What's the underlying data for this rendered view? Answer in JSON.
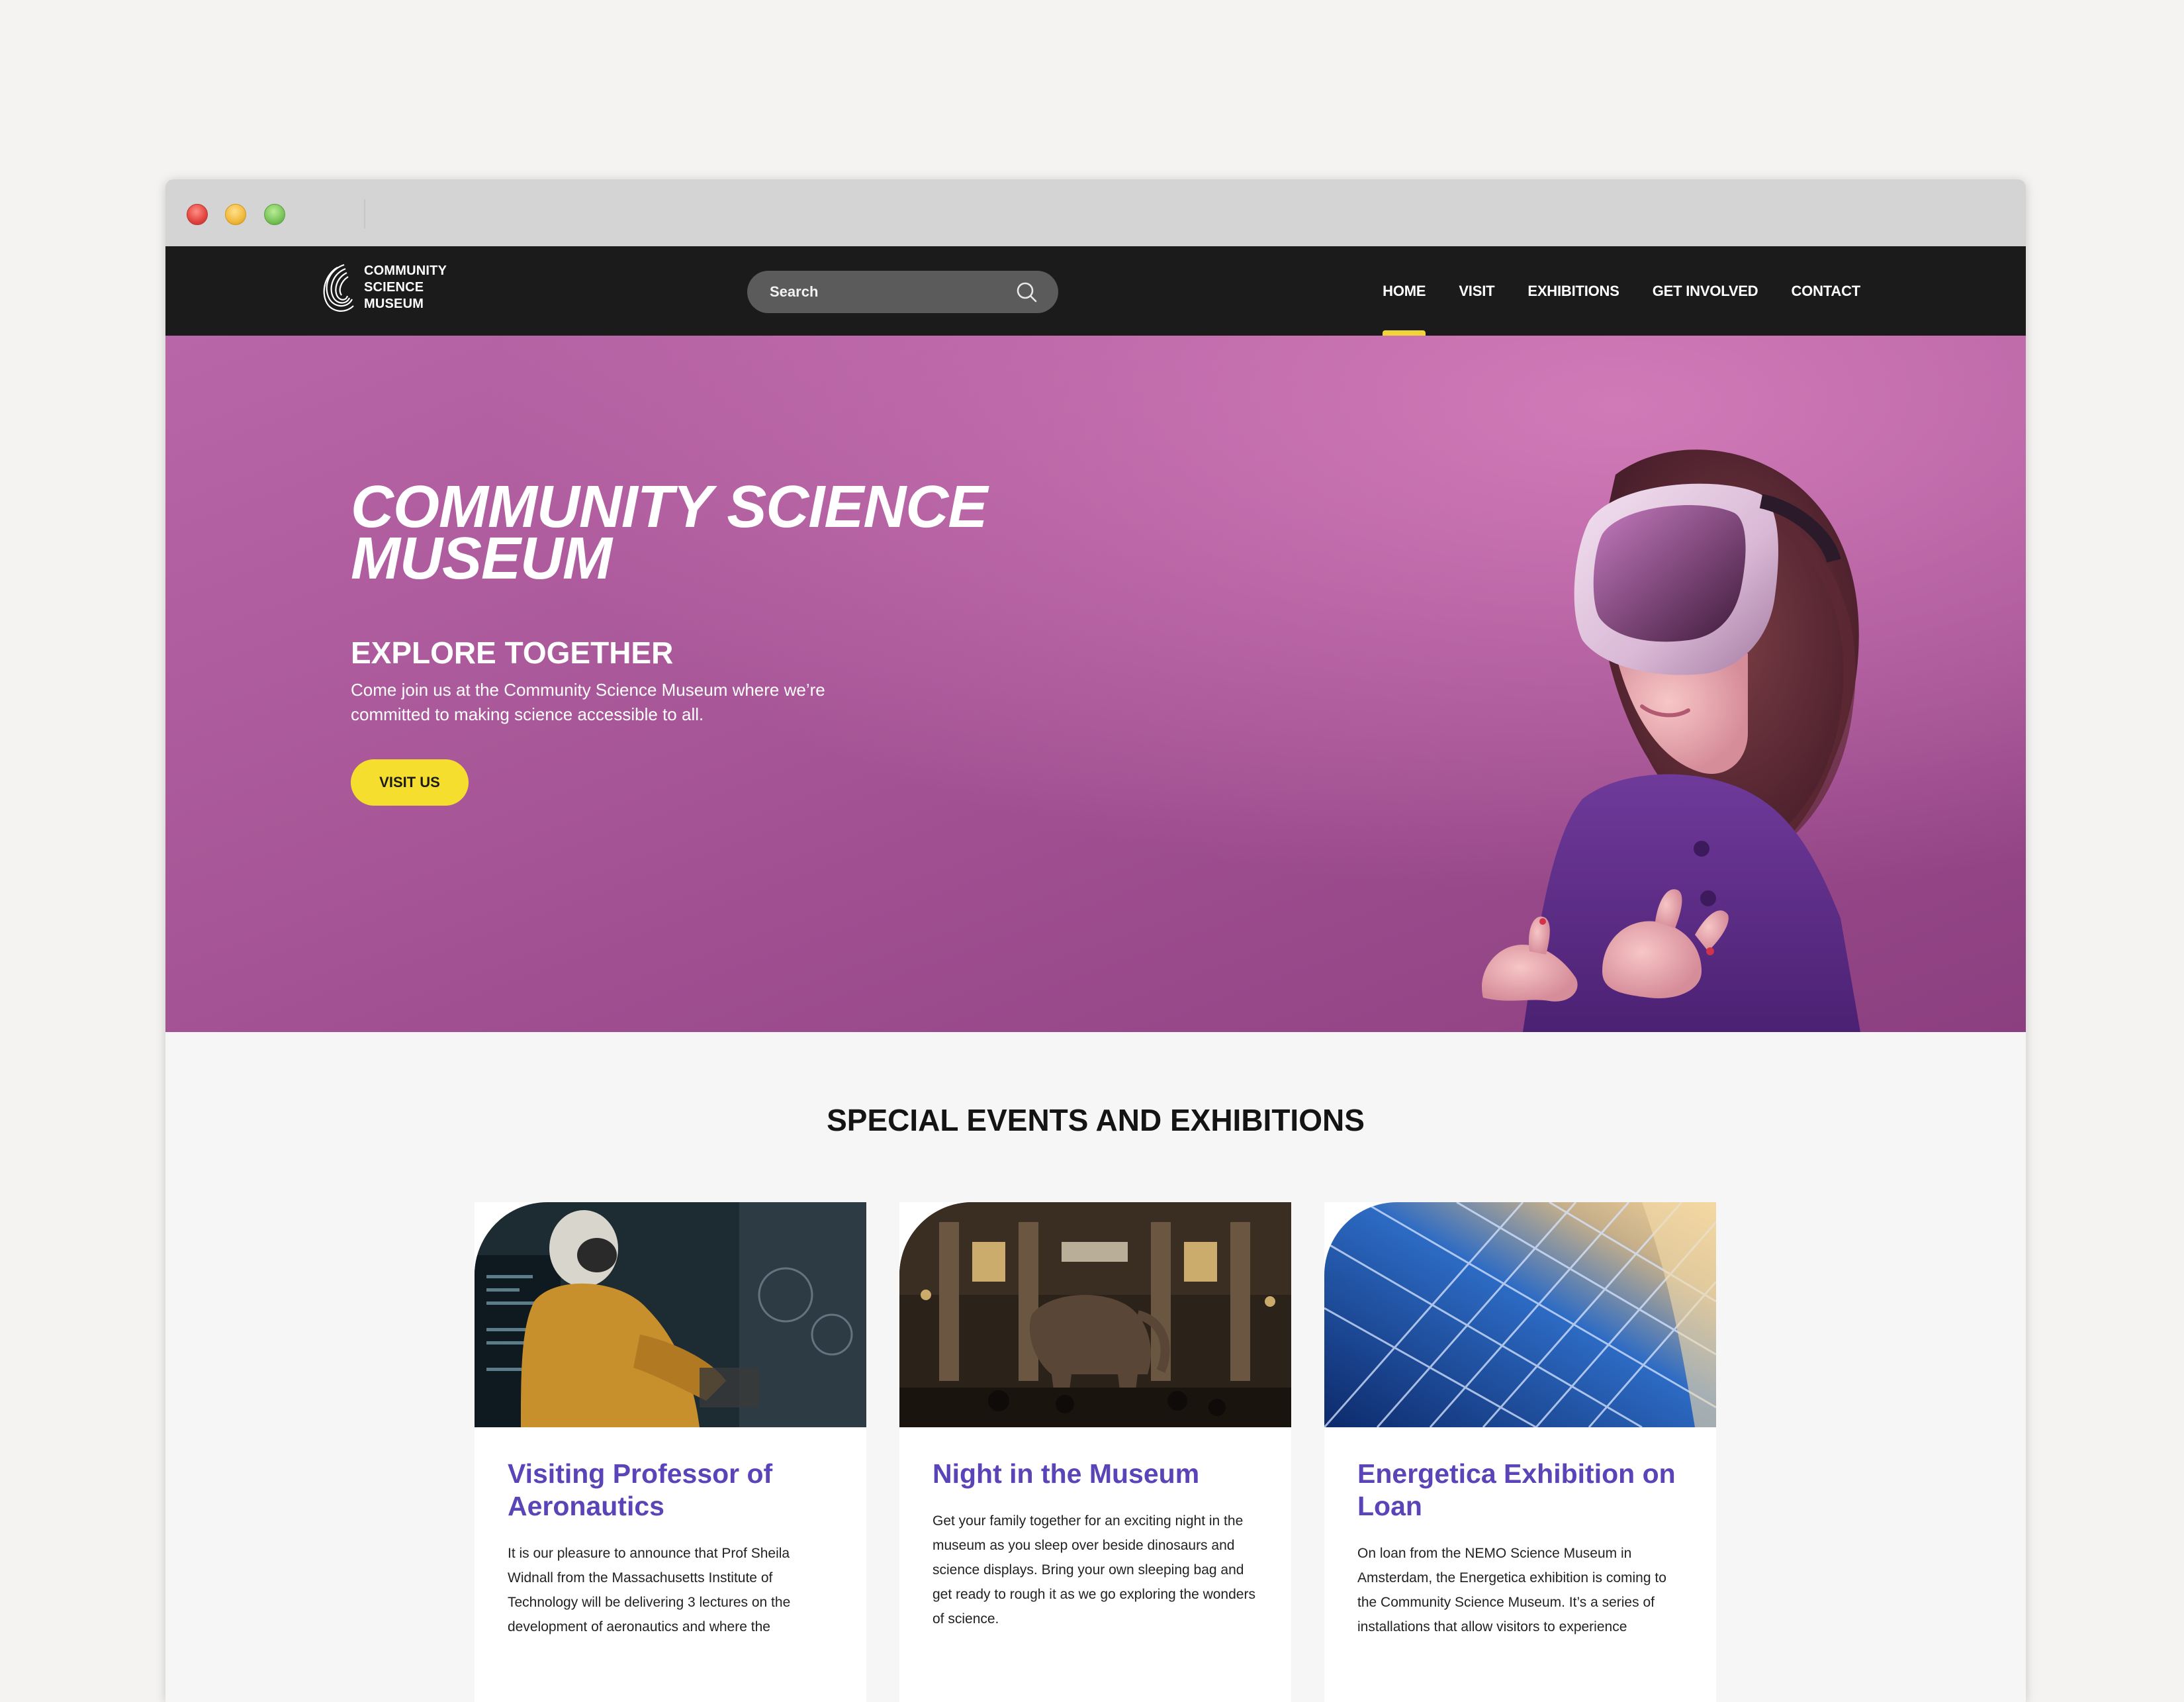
{
  "nav": {
    "logo_lines": [
      "COMMUNITY",
      "SCIENCE",
      "MUSEUM"
    ],
    "search_placeholder": "Search",
    "menu": [
      "HOME",
      "VISIT",
      "EXHIBITIONS",
      "GET INVOLVED",
      "CONTACT"
    ],
    "active_item": "HOME"
  },
  "hero": {
    "title": "COMMUNITY SCIENCE MUSEUM",
    "subtitle": "EXPLORE TOGETHER",
    "text": "Come join us at the Community Science Museum where we’re committed to making science accessible to all.",
    "button": "VISIT US"
  },
  "events": {
    "title": "SPECIAL EVENTS AND EXHIBITIONS",
    "cards": [
      {
        "title": "Visiting Professor of Aeronautics",
        "body": "It is our pleasure to announce that Prof Sheila Widnall from the Massachusetts Institute of Technology will be delivering 3 lectures on the development of aeronautics and where the"
      },
      {
        "title": "Night in the Museum",
        "body": "Get your family together for an exciting night in the museum as you sleep over beside dinosaurs and science displays. Bring your own sleeping bag and get ready to rough it as we go exploring the wonders of science."
      },
      {
        "title": "Energetica Exhibition on Loan",
        "body": "On loan from the NEMO Science Museum in Amsterdam, the Energetica exhibition is coming to the Community Science Museum. It’s a series of installations that allow visitors to experience"
      }
    ]
  },
  "colors": {
    "nav_bg": "#1b1b1b",
    "accent_yellow": "#f6de2f",
    "hero_purple": "#a65596",
    "card_title_purple": "#5b44b8"
  }
}
